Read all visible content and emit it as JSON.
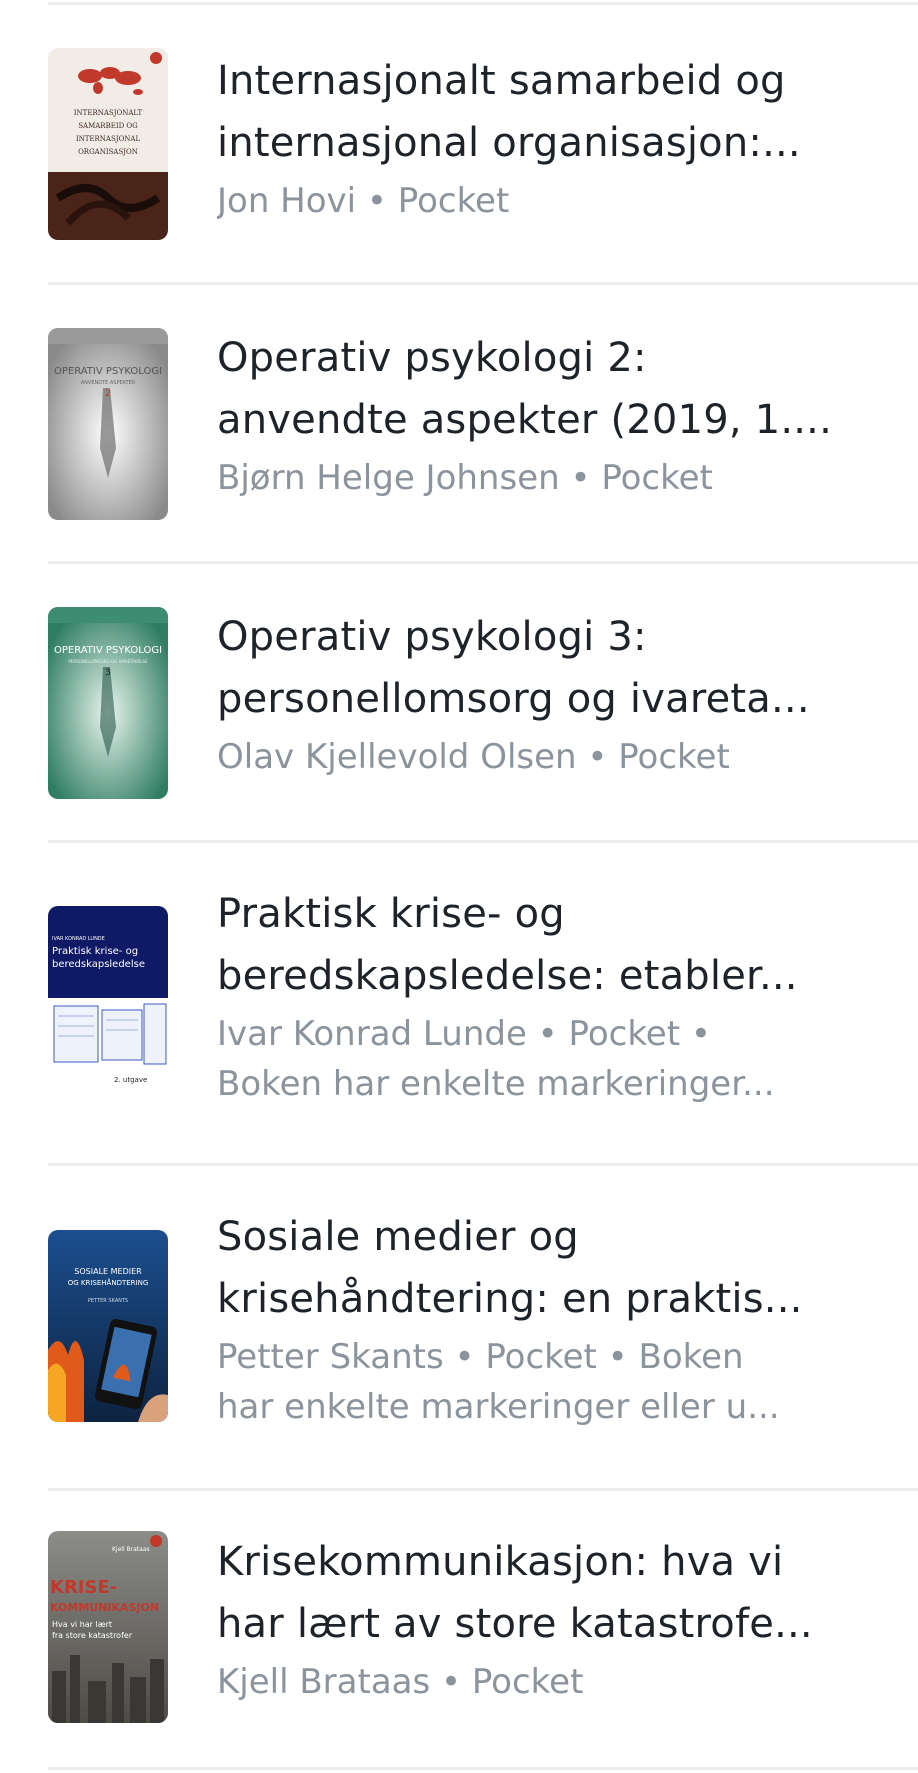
{
  "books": [
    {
      "title_line1": "Internasjonalt samarbeid og",
      "title_line2": "internasjonal organisasjon:...",
      "meta_line1": "Jon Hovi • Pocket",
      "meta_line2": "",
      "cover_icon": "world-map-book-cover",
      "cover_text": [
        "INTERNASJONALT",
        "SAMARBEID OG",
        "INTERNASJONAL",
        "ORGANISASJON"
      ]
    },
    {
      "title_line1": "Operativ psykologi 2:",
      "title_line2": "anvendte aspekter (2019, 1....",
      "meta_line1": "Bjørn Helge Johnsen • Pocket",
      "meta_line2": "",
      "cover_icon": "grey-figure-book-cover",
      "cover_text": [
        "OPERATIV PSYKOLOGI",
        "ANVENDTE ASPEKTER",
        "2"
      ]
    },
    {
      "title_line1": "Operativ psykologi 3:",
      "title_line2": "personellomsorg og ivareta...",
      "meta_line1": "Olav Kjellevold Olsen • Pocket",
      "meta_line2": "",
      "cover_icon": "green-figure-book-cover",
      "cover_text": [
        "OPERATIV PSYKOLOGI",
        "PERSONELLOMSORG OG IVARETAKELSE",
        "3"
      ]
    },
    {
      "title_line1": "Praktisk krise- og",
      "title_line2": "beredskapsledelse: etabler...",
      "meta_line1": "Ivar Konrad Lunde • Pocket •",
      "meta_line2": "Boken har enkelte markeringer...",
      "cover_icon": "navy-forms-book-cover",
      "cover_text": [
        "IVAR KONRAD LUNDE",
        "Praktisk krise- og",
        "beredskapsledelse",
        "2. utgave"
      ]
    },
    {
      "title_line1": "Sosiale medier og",
      "title_line2": "krisehåndtering: en praktis...",
      "meta_line1": "Petter Skants • Pocket • Boken",
      "meta_line2": "har enkelte markeringer eller u...",
      "cover_icon": "phone-fire-book-cover",
      "cover_text": [
        "SOSIALE MEDIER",
        "OG KRISEHÅNDTERING",
        "PETTER SKANTS"
      ]
    },
    {
      "title_line1": "Krisekommunikasjon: hva vi",
      "title_line2": "har lært av store katastrofe...",
      "meta_line1": "Kjell Brataas • Pocket",
      "meta_line2": "",
      "cover_icon": "ruins-book-cover",
      "cover_text": [
        "Kjell Brataas",
        "KRISE-",
        "KOMMUNIKASJON",
        "Hva vi har lært",
        "fra store katastrofer"
      ]
    }
  ],
  "colors": {
    "title": "#1d2329",
    "meta": "#8b939c",
    "separator": "#eeeaf0"
  }
}
